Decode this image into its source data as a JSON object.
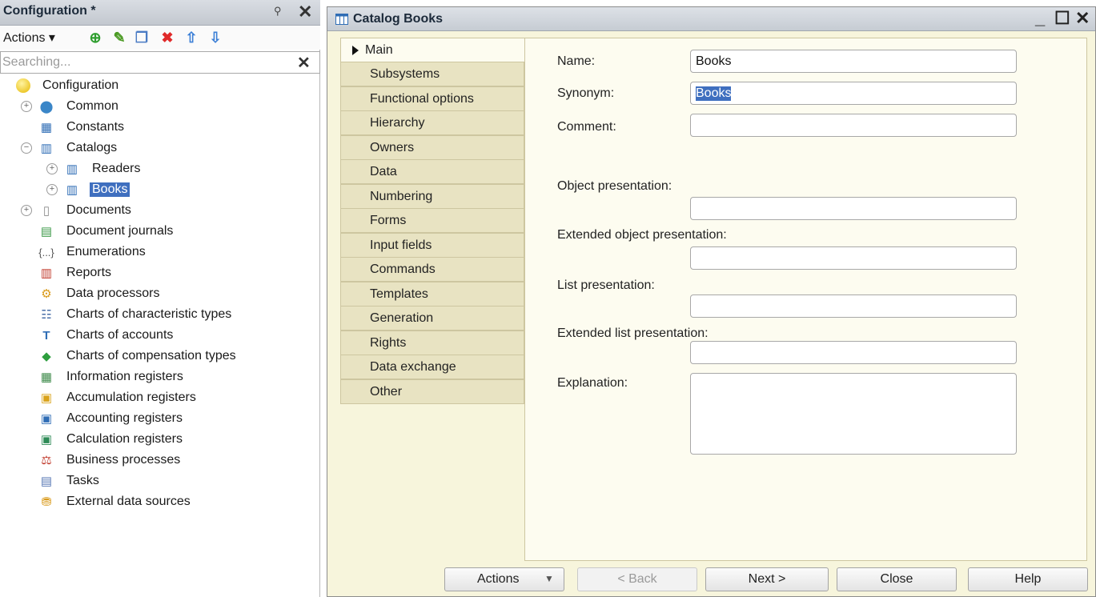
{
  "left_panel": {
    "title": "Configuration *",
    "actions_label": "Actions",
    "search_placeholder": "Searching...",
    "tree": [
      {
        "label": "Configuration",
        "icon": "configuration-icon"
      },
      {
        "label": "Common",
        "icon": "common-icon"
      },
      {
        "label": "Constants",
        "icon": "constants-icon"
      },
      {
        "label": "Catalogs",
        "icon": "catalog-icon"
      },
      {
        "label": "Readers",
        "icon": "catalog-icon"
      },
      {
        "label": "Books",
        "icon": "catalog-icon"
      },
      {
        "label": "Documents",
        "icon": "document-icon"
      },
      {
        "label": "Document journals",
        "icon": "document-journal-icon"
      },
      {
        "label": "Enumerations",
        "icon": "enumeration-icon"
      },
      {
        "label": "Reports",
        "icon": "report-icon"
      },
      {
        "label": "Data processors",
        "icon": "data-processor-icon"
      },
      {
        "label": "Charts of characteristic types",
        "icon": "chart-characteristic-icon"
      },
      {
        "label": "Charts of accounts",
        "icon": "chart-accounts-icon"
      },
      {
        "label": "Charts of compensation types",
        "icon": "chart-compensation-icon"
      },
      {
        "label": "Information registers",
        "icon": "information-register-icon"
      },
      {
        "label": "Accumulation registers",
        "icon": "accumulation-register-icon"
      },
      {
        "label": "Accounting registers",
        "icon": "accounting-register-icon"
      },
      {
        "label": "Calculation registers",
        "icon": "calculation-register-icon"
      },
      {
        "label": "Business processes",
        "icon": "business-process-icon"
      },
      {
        "label": "Tasks",
        "icon": "task-icon"
      },
      {
        "label": "External data sources",
        "icon": "external-data-icon"
      }
    ]
  },
  "window": {
    "title": "Catalog Books",
    "tabs": [
      "Main",
      "Subsystems",
      "Functional options",
      "Hierarchy",
      "Owners",
      "Data",
      "Numbering",
      "Forms",
      "Input fields",
      "Commands",
      "Templates",
      "Generation",
      "Rights",
      "Data exchange",
      "Other"
    ],
    "fields": {
      "name_label": "Name:",
      "name_value": "Books",
      "synonym_label": "Synonym:",
      "synonym_value": "Books",
      "comment_label": "Comment:",
      "comment_value": "",
      "object_presentation_label": "Object presentation:",
      "extended_object_presentation_label": "Extended object presentation:",
      "list_presentation_label": "List presentation:",
      "extended_list_presentation_label": "Extended list presentation:",
      "explanation_label": "Explanation:"
    },
    "buttons": {
      "actions": "Actions",
      "back": "< Back",
      "next": "Next >",
      "close": "Close",
      "help": "Help"
    }
  },
  "colors": {
    "selection": "#3f6fbf",
    "window_background": "#f7f5dc",
    "tab_background": "#e8e3c2"
  }
}
